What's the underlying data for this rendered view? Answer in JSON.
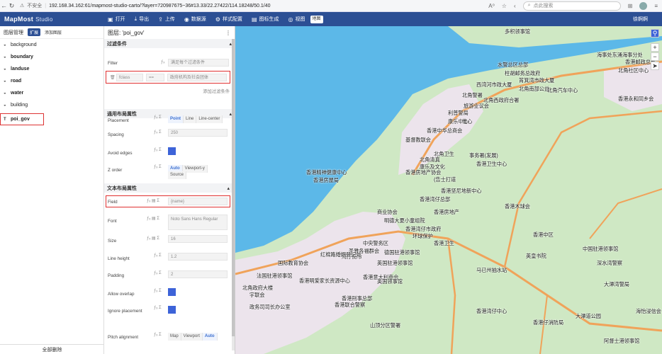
{
  "browser": {
    "warning": "不安全",
    "url": "192.168.34.162:61/mapmost-studio-carto/?layer=720987675~36#13.33/22.27422/114.18248/50.1/40",
    "search_placeholder": "点此搜索",
    "zoom_badge": "A⁰"
  },
  "app": {
    "logo": "MapMost",
    "logo_sub": "Studio",
    "toolbar": [
      "打开",
      "导出",
      "上传",
      "数据源",
      "样式配置",
      "图标生成",
      "视图"
    ],
    "map_select": "地图",
    "user": "徐婀婀"
  },
  "layers_panel": {
    "title": "图层管理",
    "expand_tag": "扩展",
    "add_layer": "添加图层",
    "layers": [
      {
        "name": "background",
        "bold": false
      },
      {
        "name": "boundary",
        "bold": true
      },
      {
        "name": "landuse",
        "bold": true
      },
      {
        "name": "road",
        "bold": true
      },
      {
        "name": "water",
        "bold": true
      },
      {
        "name": "building",
        "bold": false
      },
      {
        "name": "poi_gov",
        "bold": true
      }
    ],
    "clear_all": "全部删除"
  },
  "props": {
    "title": "图层: 'poi_gov'",
    "filter": {
      "section": "过滤条件",
      "label": "Filter",
      "mode": "满足每个过滤条件",
      "field": "fclass",
      "op": "==",
      "value": "政府机构及社会团体",
      "add": "添加过滤条件"
    },
    "layout": {
      "section": "通用布局属性",
      "placement_label": "Placement",
      "placement_opts": [
        "Point",
        "Line",
        "Line-center"
      ],
      "spacing_label": "Spacing",
      "spacing": "250",
      "avoid_edges": "Avoid edges",
      "zorder_label": "Z order",
      "zorder_opts": [
        "Auto",
        "Viewport-y",
        "Source"
      ]
    },
    "text": {
      "section": "文本布局属性",
      "field_label": "Field",
      "field_value": "{name}",
      "font_label": "Font",
      "font_value": "Noto Sans Hans Regular",
      "size_label": "Size",
      "size_value": "16",
      "lh_label": "Line height",
      "lh_value": "1.2",
      "padding_label": "Padding",
      "padding_value": "2",
      "overlap_label": "Allow overlap",
      "ignore_label": "Ignore placement",
      "pitch_label": "Pitch alignment",
      "pitch_opts": [
        "Map",
        "Viewport",
        "Auto"
      ]
    }
  },
  "map": {
    "labels": [
      "多积领事馆",
      "水警总区总部",
      "海事处东涌海事分处",
      "香港邮政总部",
      "柱胡邮务总政府",
      "西湾河市政大厦",
      "筲箕湾市政大厦",
      "北角警署",
      "北角西政府合署",
      "旅游业议会",
      "北角南部公益",
      "北角社区中心",
      "利普警局",
      "康乐中心",
      "香港永和同乡会",
      "惟心",
      "香港中华总商会",
      "基督教联会",
      "北角汽车中心",
      "北角卫生",
      "北角清真",
      "康乐及文化",
      "事务署(发展)",
      "香港卫生中心",
      "香港精神健康中心",
      "香港房屋局",
      "香港房地产协会",
      "(告士打道",
      "香港湾仔总部",
      "香港坚尼地新中心",
      "香港房地产",
      "商业协会",
      "明德大夏小童组院",
      "香港中区",
      "香港湾仔市政府",
      "环球保护",
      "香港卫生",
      "中央警务区",
      "圣雅各福群会",
      "德国驻港领事馆",
      "湾仔街市",
      "英国驻港领事馆",
      "国际教育协会",
      "红棉路婚姻登记处",
      "马已州抽水站",
      "香港意大利商会",
      "法国驻港领事馆",
      "香港明爱家长资源中心",
      "英国领事馆",
      "北角政府大楼",
      "宇联会",
      "香港刑事总部",
      "政务司司长办公室",
      "香港联合警察",
      "山顶分区警署",
      "中国驻港领事馆",
      "香港木球会",
      "英皇书院",
      "东区法院",
      "黄竹坑消防局",
      "海怡浸信会",
      "香港湾仔中心",
      "香港仔消防局",
      "阿督士港领事馆",
      "深水湾警察",
      "大潭湾警局",
      "香港仔渡轮",
      "大潭道公园"
    ],
    "colors": {
      "water": "#5cb8e8",
      "land": "#cfe8c4",
      "urban": "#ece4ec",
      "road": "#f0a35a"
    }
  }
}
